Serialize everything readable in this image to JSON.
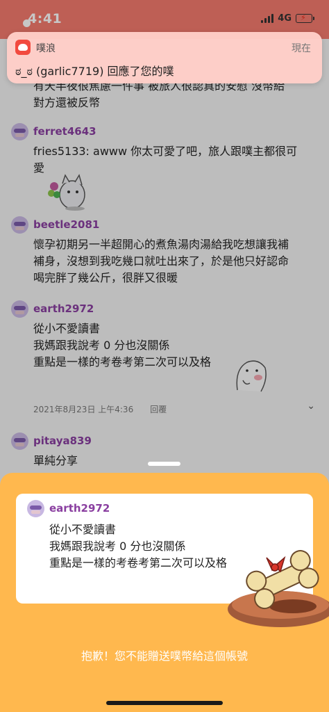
{
  "status_bar": {
    "time": "4:41",
    "network": "4G"
  },
  "notification": {
    "app_name": "噗浪",
    "time": "現在",
    "message": "ಠ_ಠ (garlic7719) 回應了您的噗"
  },
  "feed": {
    "partial_top": [
      "有天半夜很焦慮一件事 被旅人很認真的安慰 沒幣給",
      "對方還被反幣"
    ],
    "posts": [
      {
        "username": "ferret4643",
        "lines": [
          "fries5133: awww 你太可愛了吧，旅人跟噗主都很可",
          "愛"
        ]
      },
      {
        "username": "beetle2081",
        "lines": [
          "懷孕初期另一半超開心的煮魚湯肉湯給我吃想讓我補",
          "補身，沒想到我吃幾口就吐出來了，於是他只好認命",
          "喝完胖了幾公斤，很胖又很暖"
        ]
      },
      {
        "username": "earth2972",
        "lines": [
          "從小不愛讀書",
          "我媽跟我說考 0 分也沒關係",
          "重點是一樣的考卷考第二次可以及格"
        ]
      },
      {
        "username": "pitaya839",
        "lines": [
          "單純分享"
        ]
      }
    ],
    "meta": {
      "timestamp": "2021年8月23日 上午4:36",
      "reply_label": "回覆"
    }
  },
  "sheet": {
    "card": {
      "username": "earth2972",
      "lines": [
        "從小不愛讀書",
        "我媽跟我說考 0 分也沒關係",
        "重點是一樣的考卷考第二次可以及格"
      ]
    },
    "message": "抱歉！您不能贈送噗幣給這個帳號"
  },
  "colors": {
    "status_bar": "#f47a6e",
    "sheet": "#ffb84e",
    "username": "#8a3fa0",
    "app_icon": "#f24a3f"
  }
}
